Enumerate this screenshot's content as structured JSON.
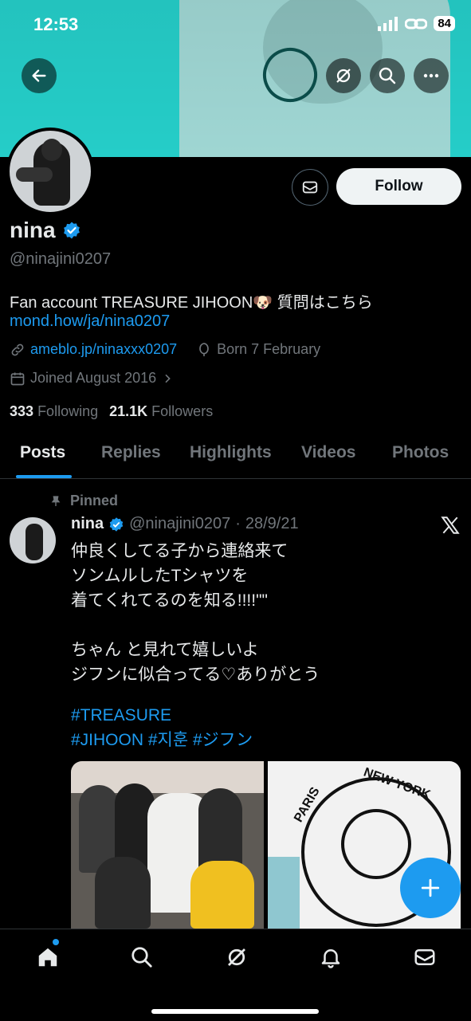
{
  "status_bar": {
    "time": "12:53",
    "battery": "84"
  },
  "profile": {
    "name": "nina",
    "handle": "@ninajini0207",
    "bio": "Fan account TREASURE JIHOON🐶 質問はこちら",
    "bio_link": "mond.how/ja/nina0207",
    "website": "ameblo.jp/ninaxxx0207",
    "birthday": "Born 7 February",
    "joined": "Joined August 2016",
    "following_count": "333",
    "following_label": "Following",
    "followers_count": "21.1K",
    "followers_label": "Followers"
  },
  "actions": {
    "follow_label": "Follow"
  },
  "tabs": [
    {
      "label": "Posts",
      "active": true
    },
    {
      "label": "Replies"
    },
    {
      "label": "Highlights"
    },
    {
      "label": "Videos"
    },
    {
      "label": "Photos"
    }
  ],
  "post": {
    "pinned_label": "Pinned",
    "author_name": "nina",
    "author_handle": "@ninajini0207",
    "separator": "·",
    "date": "28/9/21",
    "text": "仲良くしてる子から連絡来て\nソンムルしたTシャツを\n着てくれてるのを知る!!!!\"\"\n\nちゃん と見れて嬉しいよ\nジフンに似合ってる♡ありがとう",
    "hashtag_line1": "#TREASURE",
    "hashtag_line2": "#JIHOON #지훈 #ジフン",
    "image2_text1": "NEW YORK",
    "image2_text2": "PARIS"
  },
  "colors": {
    "accent": "#1d9bf0",
    "banner": "#25cdc8"
  },
  "icons": {
    "back": "arrow-left-icon",
    "grok": "grok-icon",
    "search": "search-icon",
    "more": "more-icon",
    "message": "mail-icon",
    "verified": "verified-badge-icon",
    "link": "link-icon",
    "birthday": "balloon-icon",
    "calendar": "calendar-icon",
    "pin": "pin-icon",
    "x": "x-logo-icon",
    "compose": "plus-icon",
    "home": "home-icon",
    "notifications": "bell-icon"
  }
}
